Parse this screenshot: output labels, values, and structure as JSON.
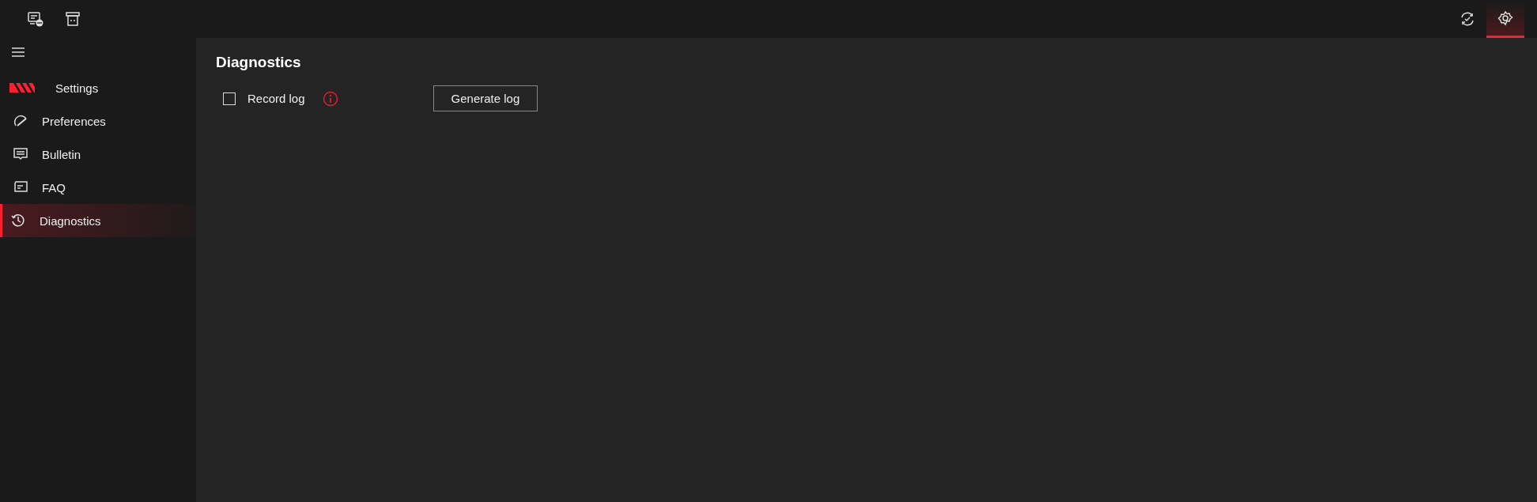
{
  "top_bar": {
    "left_icons": [
      {
        "kind": "monitor"
      },
      {
        "kind": "printer"
      }
    ],
    "right_buttons": [
      {
        "kind": "sync",
        "selected": false
      },
      {
        "kind": "settings",
        "selected": true
      }
    ]
  },
  "sidebar": {
    "title": "Settings",
    "items": [
      {
        "kind": "preferences",
        "label": "Preferences",
        "selected": false
      },
      {
        "kind": "bulletin",
        "label": "Bulletin",
        "selected": false
      },
      {
        "kind": "faq",
        "label": "FAQ",
        "selected": false
      },
      {
        "kind": "diagnostics",
        "label": "Diagnostics",
        "selected": true
      }
    ]
  },
  "content": {
    "heading": "Diagnostics",
    "record_log": {
      "label": "Record log",
      "checked": false
    },
    "generate_button": "Generate log"
  }
}
